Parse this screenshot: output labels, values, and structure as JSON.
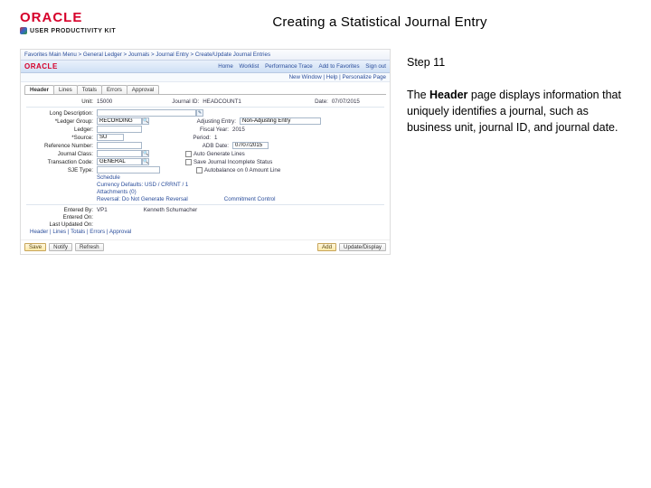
{
  "header": {
    "logo_text": "ORACLE",
    "logo_sub": "USER PRODUCTIVITY KIT",
    "title": "Creating a Statistical Journal Entry"
  },
  "instruction": {
    "step": "Step 11",
    "text_pre": "The ",
    "text_bold": "Header",
    "text_post": " page displays information that uniquely identifies a journal, such as business unit, journal ID, and journal date."
  },
  "mini": {
    "crumbs_left": "Favorites  Main Menu > General Ledger > Journals > Journal Entry > Create/Update Journal Entries",
    "brand_links": [
      "Home",
      "Worklist",
      "Performance Trace",
      "Add to Favorites",
      "Sign out"
    ],
    "userline": "New Window | Help | Personalize Page",
    "tabs": [
      "Header",
      "Lines",
      "Totals",
      "Errors",
      "Approval"
    ],
    "row_unit": {
      "label": "Unit:",
      "value": "15000"
    },
    "row_journal": {
      "label": "Journal ID:",
      "value": "HEADCOUNT1"
    },
    "row_date": {
      "label": "Date:",
      "value": "07/07/2015"
    },
    "long_desc_label": "Long Description:",
    "ledger_group": {
      "label": "*Ledger Group:",
      "value": "RECORDING"
    },
    "adjusting": {
      "label": "Adjusting Entry:",
      "value": "Non-Adjusting Entry"
    },
    "ledger": {
      "label": "Ledger:"
    },
    "fiscal_year": {
      "label": "Fiscal Year:",
      "value": "2015"
    },
    "source": {
      "label": "*Source:",
      "value": "SU"
    },
    "period": {
      "label": "Period:",
      "value": "1"
    },
    "reference": {
      "label": "Reference Number:"
    },
    "adb_date": {
      "label": "ADB Date:",
      "value": "07/07/2015"
    },
    "journal_class": {
      "label": "Journal Class:"
    },
    "autogen": "Auto Generate Lines",
    "trans_code": {
      "label": "Transaction Code:",
      "value": "GENERAL"
    },
    "save_incomplete": "Save Journal Incomplete Status",
    "sjetype": {
      "label": "SJE Type:"
    },
    "autobalance": "Autobalance on 0 Amount Line",
    "sched_link": "Schedule",
    "currency_def": "Currency Defaults: USD / CRRNT / 1",
    "attach_link": "Attachments (0)",
    "reversal": "Reversal: Do Not Generate Reversal",
    "commit_link": "Commitment Control",
    "entered_by": {
      "label": "Entered By:",
      "value": "VP1"
    },
    "entered_by_name": "Kenneth Schumacher",
    "entered_on": {
      "label": "Entered On:"
    },
    "last_upd": {
      "label": "Last Updated On:"
    },
    "bottom_tabs": "Header | Lines | Totals | Errors | Approval",
    "footer": {
      "save": "Save",
      "notify": "Notify",
      "refresh": "Refresh",
      "add": "Add",
      "update": "Update/Display"
    }
  }
}
